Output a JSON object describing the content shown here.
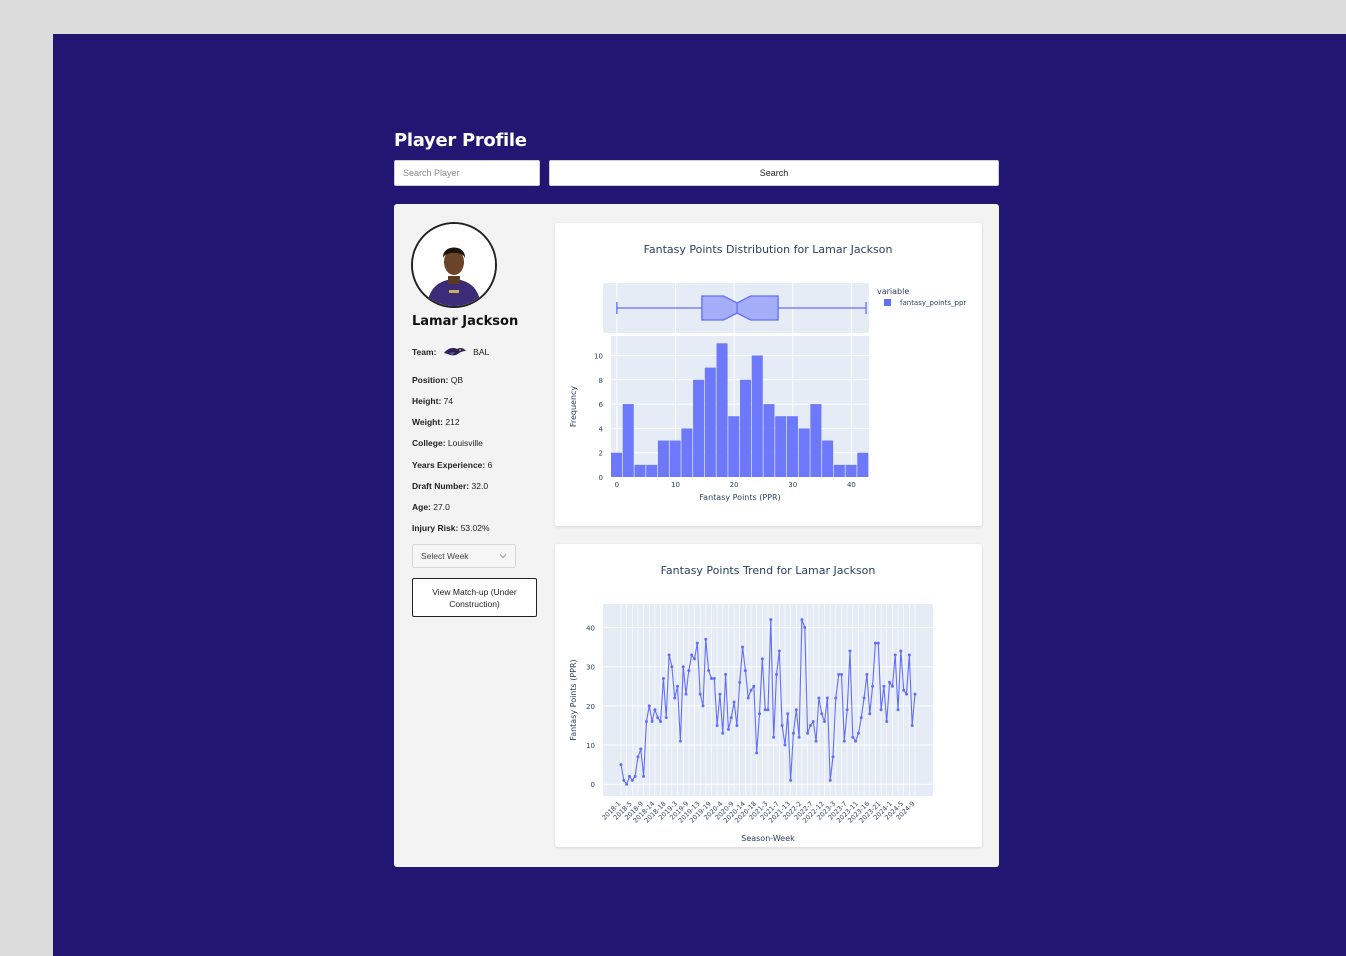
{
  "header": {
    "title": "Player Profile"
  },
  "search": {
    "placeholder": "Search Player",
    "button_label": "Search"
  },
  "player": {
    "name": "Lamar Jackson",
    "team": {
      "label": "Team:",
      "value": "BAL"
    },
    "details": [
      {
        "label": "Position:",
        "value": "QB"
      },
      {
        "label": "Height:",
        "value": "74"
      },
      {
        "label": "Weight:",
        "value": "212"
      },
      {
        "label": "College:",
        "value": "Louisville"
      },
      {
        "label": "Years Experience:",
        "value": "6"
      },
      {
        "label": "Draft Number:",
        "value": "32.0"
      },
      {
        "label": "Age:",
        "value": "27.0"
      },
      {
        "label": "Injury Risk:",
        "value": "53.02%"
      }
    ]
  },
  "controls": {
    "week_select": "Select Week",
    "matchup_button": "View Match-up (Under Construction)"
  },
  "colors": {
    "background": "#221672",
    "series": "#636efa",
    "plot_bg": "#e5ecf6"
  },
  "chart_data": [
    {
      "type": "bar",
      "title": "Fantasy Points Distribution for Lamar Jackson",
      "xlabel": "Fantasy Points (PPR)",
      "ylabel": "Frequency",
      "xticks": [
        0,
        10,
        20,
        30,
        40
      ],
      "yticks": [
        0,
        2,
        4,
        6,
        8,
        10
      ],
      "xlim": [
        -1,
        43
      ],
      "ylim": [
        0,
        11.6
      ],
      "bin_width": 2,
      "bin_starts": [
        -1,
        1,
        3,
        5,
        7,
        9,
        11,
        13,
        15,
        17,
        19,
        21,
        23,
        25,
        27,
        29,
        31,
        33,
        35,
        37,
        39,
        41
      ],
      "values": [
        2,
        6,
        1,
        1,
        3,
        3,
        4,
        8,
        9,
        11,
        5,
        8,
        10,
        6,
        5,
        5,
        4,
        6,
        3,
        1,
        1,
        2
      ],
      "legend": {
        "title": "variable",
        "entries": [
          "fantasy_points_ppr"
        ],
        "position": "top-right"
      },
      "boxplot": {
        "min": 0,
        "q1": 14.5,
        "median": 20.5,
        "q3": 27.5,
        "max": 42.5
      }
    },
    {
      "type": "line",
      "title": "Fantasy Points Trend for Lamar Jackson",
      "xlabel": "Season-Week",
      "ylabel": "Fantasy Points (PPR)",
      "yticks": [
        0,
        10,
        20,
        30,
        40
      ],
      "ylim": [
        -3,
        46
      ],
      "xtick_labels": [
        "2018-1",
        "2018-5",
        "2018-9",
        "2018-14",
        "2018-18",
        "2019-3",
        "2019-9",
        "2019-13",
        "2019-19",
        "2020-4",
        "2020-9",
        "2020-14",
        "2020-18",
        "2021-3",
        "2021-7",
        "2021-13",
        "2022-2",
        "2022-7",
        "2022-12",
        "2023-3",
        "2023-7",
        "2023-11",
        "2023-16",
        "2023-21",
        "2024-1",
        "2024-5",
        "2024-9"
      ],
      "values": [
        5,
        1,
        0,
        2,
        1,
        2,
        7,
        9,
        2,
        16,
        20,
        16,
        19,
        17,
        16,
        27,
        17,
        33,
        30,
        22,
        25,
        11,
        30,
        23,
        29,
        33,
        32,
        36,
        23,
        20,
        37,
        29,
        27,
        27,
        15,
        23,
        13,
        28,
        14,
        17,
        21,
        15,
        26,
        35,
        29,
        22,
        24,
        25,
        8,
        18,
        32,
        19,
        19,
        42,
        12,
        28,
        34,
        15,
        10,
        18,
        1,
        13,
        19,
        12,
        42,
        40,
        13,
        15,
        16,
        11,
        22,
        18,
        16,
        22,
        1,
        7,
        22,
        28,
        28,
        11,
        19,
        34,
        12,
        11,
        13,
        17,
        22,
        28,
        18,
        25,
        36,
        36,
        19,
        25,
        16,
        26,
        25,
        33,
        19,
        34,
        24,
        23,
        33,
        15,
        23
      ]
    }
  ]
}
